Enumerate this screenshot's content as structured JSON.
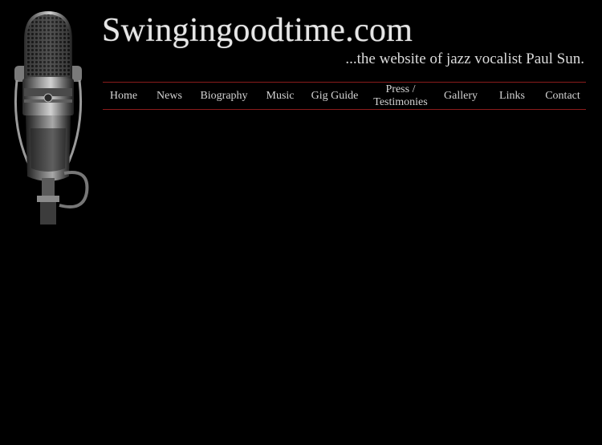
{
  "header": {
    "title": "Swingingoodtime.com",
    "tagline": "...the website of jazz vocalist Paul Sun."
  },
  "nav": {
    "items": [
      {
        "label": "Home"
      },
      {
        "label": "News"
      },
      {
        "label": "Biography"
      },
      {
        "label": "Music"
      },
      {
        "label": "Gig Guide"
      },
      {
        "label_line1": "Press /",
        "label_line2": "Testimonies"
      },
      {
        "label": "Gallery"
      },
      {
        "label": "Links"
      },
      {
        "label": "Contact"
      }
    ]
  },
  "colors": {
    "background": "#000000",
    "nav_rule": "#8a1c1c",
    "text": "#d4d4d4"
  },
  "icons": {
    "logo_image": "vintage-microphone-icon"
  }
}
